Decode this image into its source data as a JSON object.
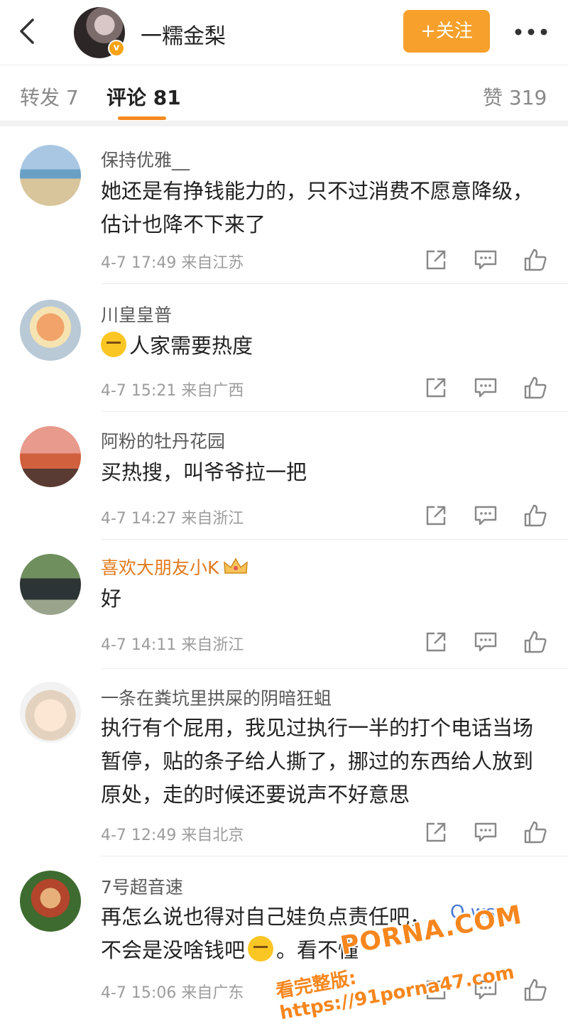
{
  "header": {
    "title": "一糯金梨",
    "verified_badge": "v",
    "follow_label": "+关注",
    "back_icon": "chevron-left-icon",
    "more_icon": "more-dots-icon"
  },
  "tabs": {
    "repost": "转发 7",
    "comments": "评论 81",
    "likes": "赞 319",
    "active": "comments",
    "accent_color": "#f58a1f"
  },
  "comments": [
    {
      "user": "保持优雅__",
      "text": "她还是有挣钱能力的，只不过消费不愿意降级，估计也降不下来了",
      "meta": "4-7 17:49 来自江苏"
    },
    {
      "user": "川皇皇普",
      "text": "人家需要热度",
      "meta": "4-7 15:21 来自广西"
    },
    {
      "user": "阿粉的牡丹花园",
      "text": "买热搜，叫爷爷拉一把",
      "meta": "4-7 14:27 来自浙江"
    },
    {
      "user": "喜欢大朋友小K",
      "text": "好",
      "meta": "4-7 14:11 来自浙江"
    },
    {
      "user": "一条在粪坑里拱屎的阴暗狂蛆",
      "text": "执行有个屁用，我见过执行一半的打个电话当场暂停，贴的条子给人撕了，挪过的东西给人放到原处，走的时候还要说声不好意思",
      "meta": "4-7 12:49 来自北京"
    },
    {
      "user": "7号超音速",
      "text": "再怎么说也得对自己娃负点责任吧，",
      "text2": "不会是没啥钱吧",
      "text3": "。看不懂",
      "meta": "4-7 15:06 来自广东"
    }
  ],
  "overlay": {
    "search_hint": "Q wsc",
    "watermark_main": "PORNA.COM",
    "watermark_sub": "看完整版: https://91porna47.com"
  }
}
